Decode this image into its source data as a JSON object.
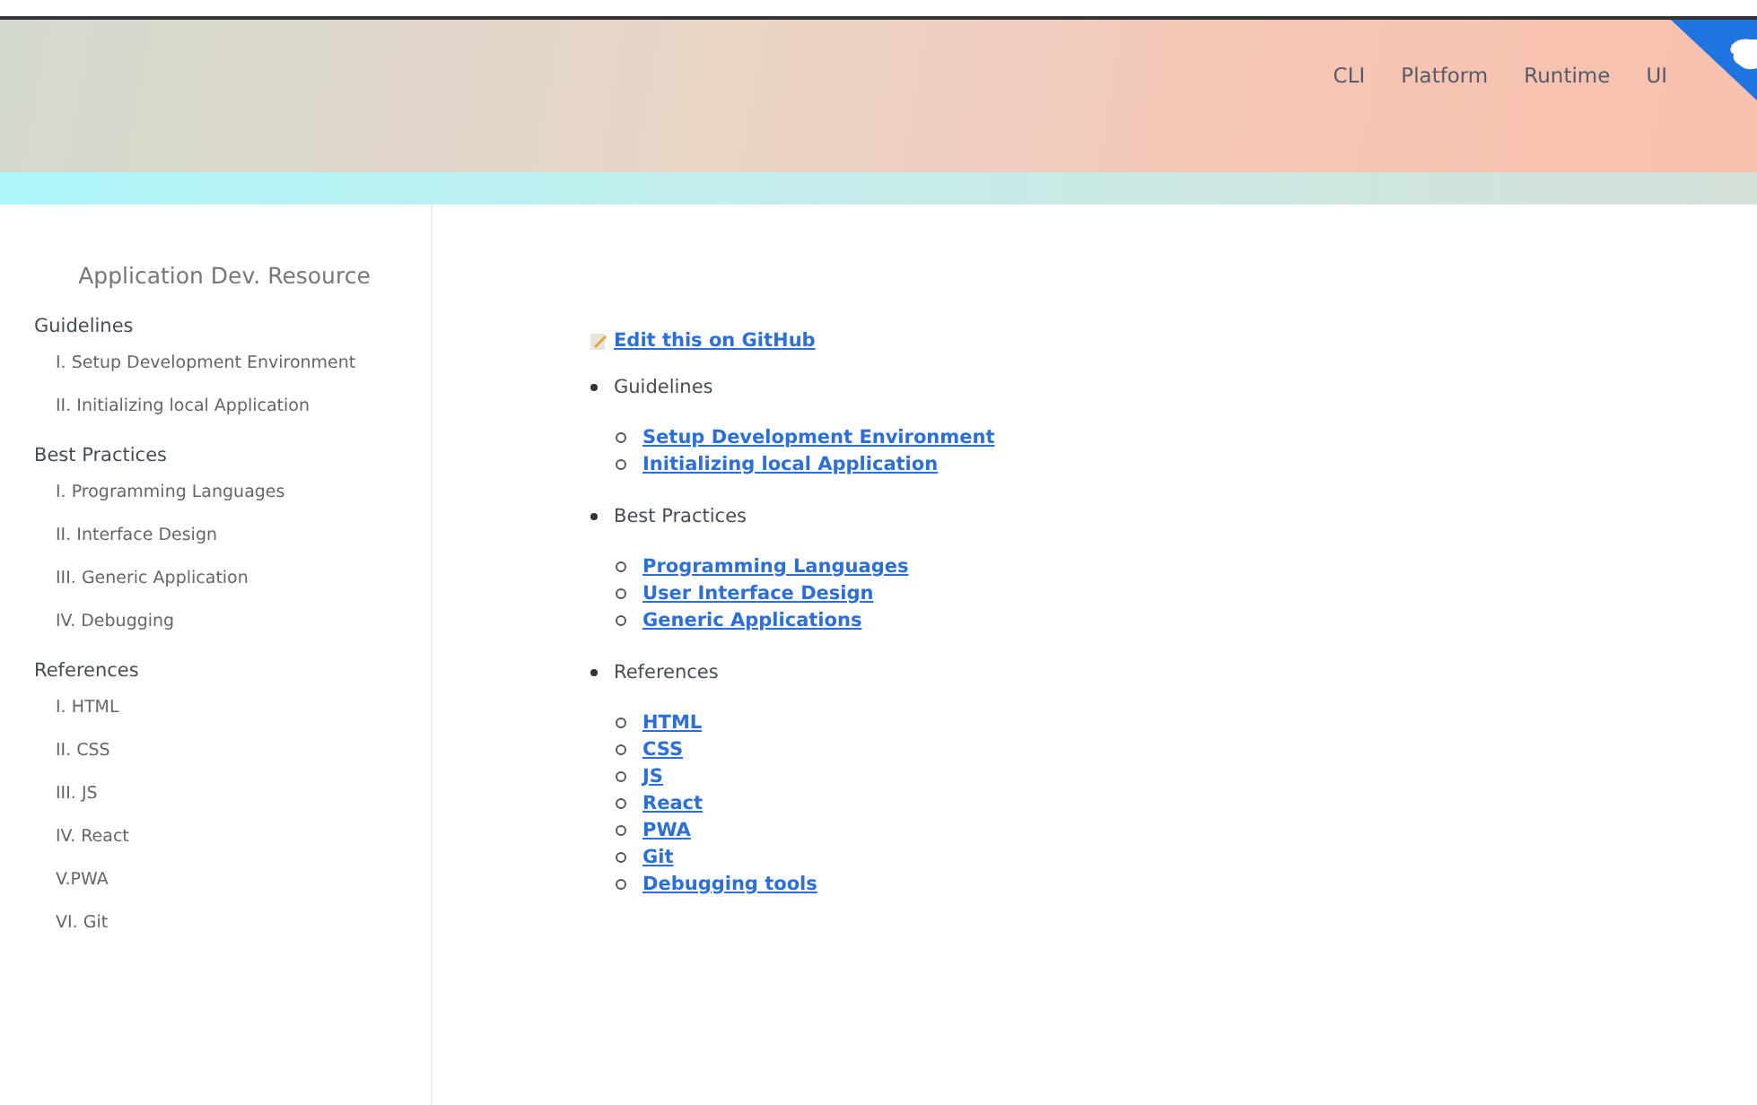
{
  "header": {
    "nav": [
      "CLI",
      "Platform",
      "Runtime",
      "UI"
    ]
  },
  "sidebar": {
    "title": "Application Dev. Resource",
    "sections": [
      {
        "label": "Guidelines",
        "items": [
          "I. Setup Development Environment",
          "II. Initializing local Application"
        ]
      },
      {
        "label": "Best Practices",
        "items": [
          "I. Programming Languages",
          "II. Interface Design",
          "III. Generic Application",
          "IV. Debugging"
        ]
      },
      {
        "label": "References",
        "items": [
          "I. HTML",
          "II. CSS",
          "III. JS",
          "IV. React",
          "V.PWA",
          "VI. Git"
        ]
      }
    ]
  },
  "content": {
    "edit_link": "Edit this on GitHub",
    "sections": [
      {
        "label": "Guidelines",
        "links": [
          "Setup Development Environment",
          "Initializing local Application"
        ]
      },
      {
        "label": "Best Practices",
        "links": [
          "Programming Languages",
          "User Interface Design",
          "Generic Applications"
        ]
      },
      {
        "label": "References",
        "links": [
          "HTML",
          "CSS",
          "JS",
          "React",
          "PWA",
          "Git",
          "Debugging tools"
        ]
      }
    ]
  }
}
